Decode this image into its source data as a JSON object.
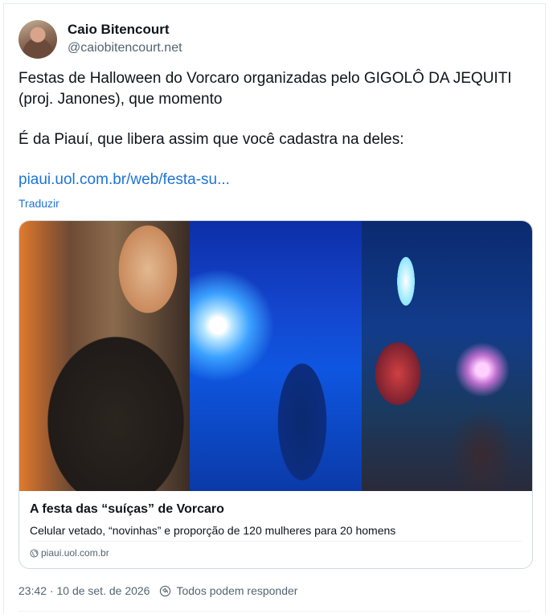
{
  "author": {
    "name": "Caio Bitencourt",
    "handle": "@caiobitencourt.net"
  },
  "post": {
    "line1": "Festas de Halloween do Vorcaro organizadas pelo GIGOLÔ DA JEQUITI (proj. Janones), que momento",
    "line2": "É da Piauí, que libera assim que você cadastra na deles:",
    "link": "piaui.uol.com.br/web/festa-su...",
    "translate": "Traduzir"
  },
  "card": {
    "title": "A festa das “suíças” de Vorcaro",
    "description": "Celular vetado, “novinhas” e proporção de 120 mulheres para 20 homens",
    "domain": "piaui.uol.com.br"
  },
  "meta": {
    "timestamp": "23:42 · 10 de set. de 2026",
    "reply_setting": "Todos podem responder"
  },
  "colors": {
    "link": "#1d74d8",
    "secondary": "#536471",
    "text": "#0f1419"
  },
  "icons": [
    "globe-icon",
    "reply-settings-icon"
  ]
}
